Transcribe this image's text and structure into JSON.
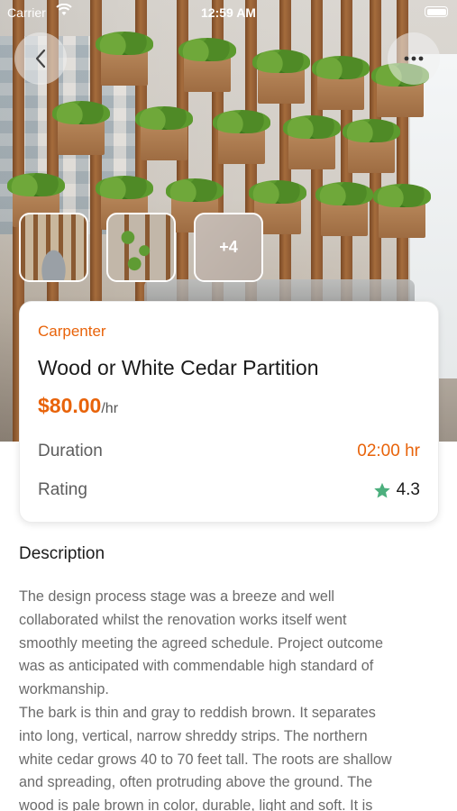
{
  "status_bar": {
    "carrier": "Carrier",
    "time": "12:59 AM"
  },
  "hero": {
    "more_thumbnails_label": "+4"
  },
  "service": {
    "category": "Carpenter",
    "title": "Wood or White Cedar Partition",
    "price": "$80.00",
    "price_unit": "/hr",
    "duration_label": "Duration",
    "duration_value": "02:00 hr",
    "rating_label": "Rating",
    "rating_value": "4.3"
  },
  "description": {
    "heading": "Description",
    "lines": [
      "The design process stage was a breeze and well",
      "collaborated whilst the renovation works itself went",
      "smoothly meeting the agreed schedule. Project outcome",
      "was as anticipated with commendable high standard of",
      "workmanship.",
      "The bark is thin and gray to reddish brown. It separates",
      "into long, vertical, narrow shreddy strips. The northern",
      "white cedar grows 40 to 70 feet tall. The roots are shallow",
      "and spreading, often protruding above the ground. The",
      "wood is pale brown in color, durable, light and soft. It is"
    ]
  },
  "colors": {
    "accent": "#e8630a",
    "star": "#4caf7d"
  },
  "icons": {
    "back": "chevron-left-icon",
    "more": "more-horizontal-icon",
    "rating": "star-icon"
  }
}
